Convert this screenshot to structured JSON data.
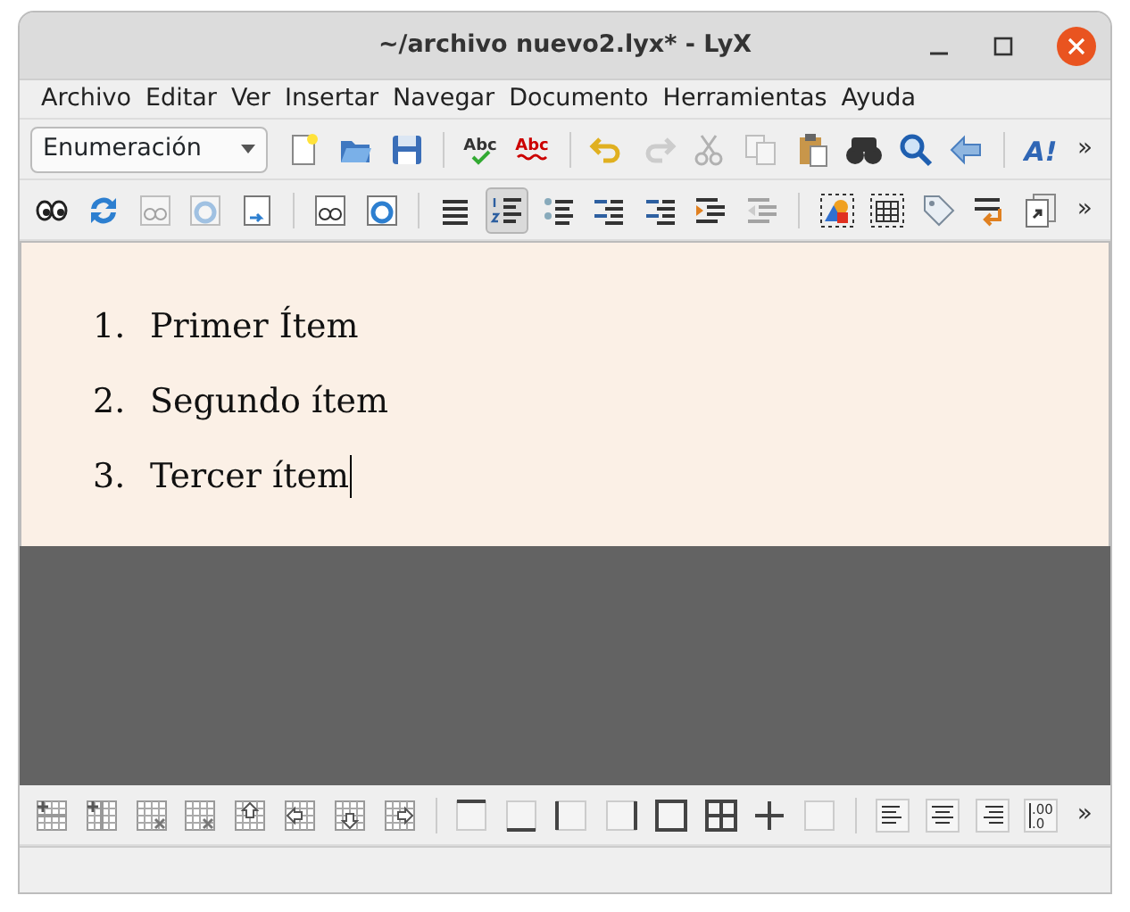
{
  "window": {
    "title": "~/archivo nuevo2.lyx* - LyX"
  },
  "menu": [
    {
      "label": "Archivo"
    },
    {
      "label": "Editar"
    },
    {
      "label": "Ver"
    },
    {
      "label": "Insertar"
    },
    {
      "label": "Navegar"
    },
    {
      "label": "Documento"
    },
    {
      "label": "Herramientas"
    },
    {
      "label": "Ayuda"
    }
  ],
  "toolbar_1": {
    "layout_select": "Enumeración",
    "overflow": "»",
    "items": [
      {
        "kind": "new",
        "disabled": false
      },
      {
        "kind": "open",
        "disabled": false
      },
      {
        "kind": "save",
        "disabled": false
      },
      {
        "kind": "separator"
      },
      {
        "kind": "spell",
        "label": "Abc",
        "disabled": false
      },
      {
        "kind": "spell-wave",
        "label": "Abc",
        "disabled": false
      },
      {
        "kind": "separator"
      },
      {
        "kind": "undo",
        "disabled": false
      },
      {
        "kind": "redo",
        "disabled": true
      },
      {
        "kind": "cut",
        "disabled": true
      },
      {
        "kind": "copy",
        "disabled": true
      },
      {
        "kind": "paste",
        "disabled": false
      },
      {
        "kind": "binoculars",
        "disabled": false
      },
      {
        "kind": "search",
        "disabled": false
      },
      {
        "kind": "back",
        "disabled": false
      },
      {
        "kind": "separator"
      },
      {
        "kind": "textstyle",
        "label": "A!",
        "disabled": false
      }
    ]
  },
  "toolbar_2": {
    "overflow": "»",
    "items": [
      {
        "kind": "eyes",
        "disabled": false,
        "selected": false
      },
      {
        "kind": "refresh",
        "disabled": false,
        "selected": false
      },
      {
        "kind": "eyes-doc",
        "disabled": true,
        "selected": false
      },
      {
        "kind": "refresh-doc",
        "disabled": true,
        "selected": false
      },
      {
        "kind": "export",
        "disabled": false,
        "selected": false
      },
      {
        "kind": "separator"
      },
      {
        "kind": "eyes-doc",
        "disabled": false,
        "selected": false
      },
      {
        "kind": "refresh-doc",
        "disabled": false,
        "selected": false
      },
      {
        "kind": "separator"
      },
      {
        "kind": "lines",
        "disabled": false,
        "selected": false
      },
      {
        "kind": "numbered",
        "disabled": false,
        "selected": true
      },
      {
        "kind": "bullets",
        "disabled": false,
        "selected": false
      },
      {
        "kind": "description",
        "disabled": false,
        "selected": false
      },
      {
        "kind": "description",
        "disabled": false,
        "selected": false
      },
      {
        "kind": "indent",
        "disabled": false,
        "selected": false
      },
      {
        "kind": "outdent",
        "disabled": true,
        "selected": false
      },
      {
        "kind": "separator"
      },
      {
        "kind": "figure",
        "disabled": false,
        "selected": false
      },
      {
        "kind": "table",
        "disabled": false,
        "selected": false
      },
      {
        "kind": "tag",
        "disabled": false,
        "selected": false
      },
      {
        "kind": "wrap",
        "disabled": false,
        "selected": false
      },
      {
        "kind": "docs",
        "disabled": false,
        "selected": false
      }
    ]
  },
  "document": {
    "items": [
      {
        "number": "1.",
        "text": "Primer Ítem",
        "cursor": false
      },
      {
        "number": "2.",
        "text": "Segundo ítem",
        "cursor": false
      },
      {
        "number": "3.",
        "text": "Tercer ítem",
        "cursor": true
      }
    ]
  },
  "table_toolbar": {
    "overflow": "»",
    "items": [
      {
        "kind": "add-row",
        "disabled": false
      },
      {
        "kind": "add-col",
        "disabled": false
      },
      {
        "kind": "del-row",
        "disabled": false
      },
      {
        "kind": "del-col",
        "disabled": false
      },
      {
        "kind": "row-up",
        "disabled": false
      },
      {
        "kind": "col-left",
        "disabled": false
      },
      {
        "kind": "row-down",
        "disabled": false
      },
      {
        "kind": "col-right",
        "disabled": false
      },
      {
        "kind": "separator"
      },
      {
        "kind": "border-top",
        "disabled": false
      },
      {
        "kind": "border-bottom",
        "disabled": false
      },
      {
        "kind": "border-left",
        "disabled": false
      },
      {
        "kind": "border-right",
        "disabled": false
      },
      {
        "kind": "border-outer",
        "disabled": false
      },
      {
        "kind": "border-all",
        "disabled": false
      },
      {
        "kind": "border-inner",
        "disabled": false
      },
      {
        "kind": "border-none",
        "disabled": false
      },
      {
        "kind": "separator"
      },
      {
        "kind": "align-left",
        "disabled": false
      },
      {
        "kind": "align-center",
        "disabled": false
      },
      {
        "kind": "align-right",
        "disabled": false
      },
      {
        "kind": "decimal",
        "label_top": ".00",
        "label_bottom": ".0",
        "disabled": false
      }
    ]
  }
}
